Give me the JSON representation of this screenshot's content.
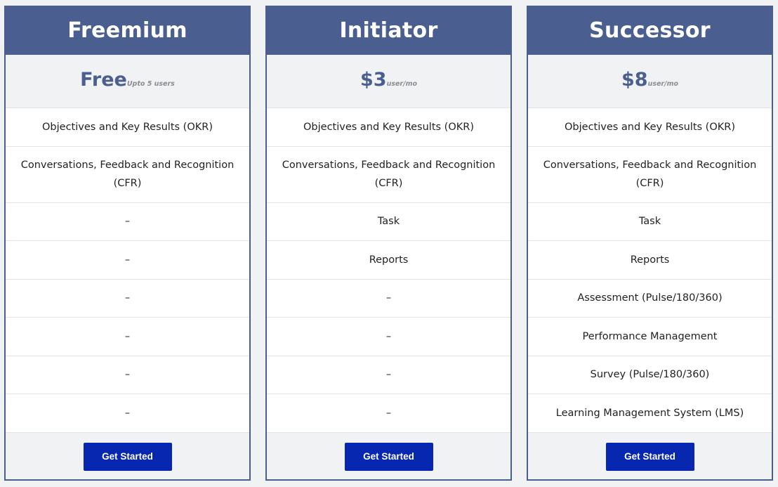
{
  "colors": {
    "header_bg": "#4a5f8f",
    "price_text": "#4a5f8f",
    "button_bg": "#0727b0",
    "row_alt_bg": "#f1f2f4"
  },
  "plans": [
    {
      "name": "Freemium",
      "price": "Free",
      "price_note": "Upto 5 users",
      "features": [
        "Objectives and Key Results (OKR)",
        "Conversations, Feedback and Recognition (CFR)",
        "–",
        "–",
        "–",
        "–",
        "–",
        "–"
      ],
      "cta": "Get Started"
    },
    {
      "name": "Initiator",
      "price": "$3",
      "price_note": "user/mo",
      "features": [
        "Objectives and Key Results (OKR)",
        "Conversations, Feedback and Recognition (CFR)",
        "Task",
        "Reports",
        "–",
        "–",
        "–",
        "–"
      ],
      "cta": "Get Started"
    },
    {
      "name": "Successor",
      "price": "$8",
      "price_note": "user/mo",
      "features": [
        "Objectives and Key Results (OKR)",
        "Conversations, Feedback and Recognition (CFR)",
        "Task",
        "Reports",
        "Assessment (Pulse/180/360)",
        "Performance Management",
        "Survey (Pulse/180/360)",
        "Learning Management System (LMS)"
      ],
      "cta": "Get Started"
    }
  ]
}
